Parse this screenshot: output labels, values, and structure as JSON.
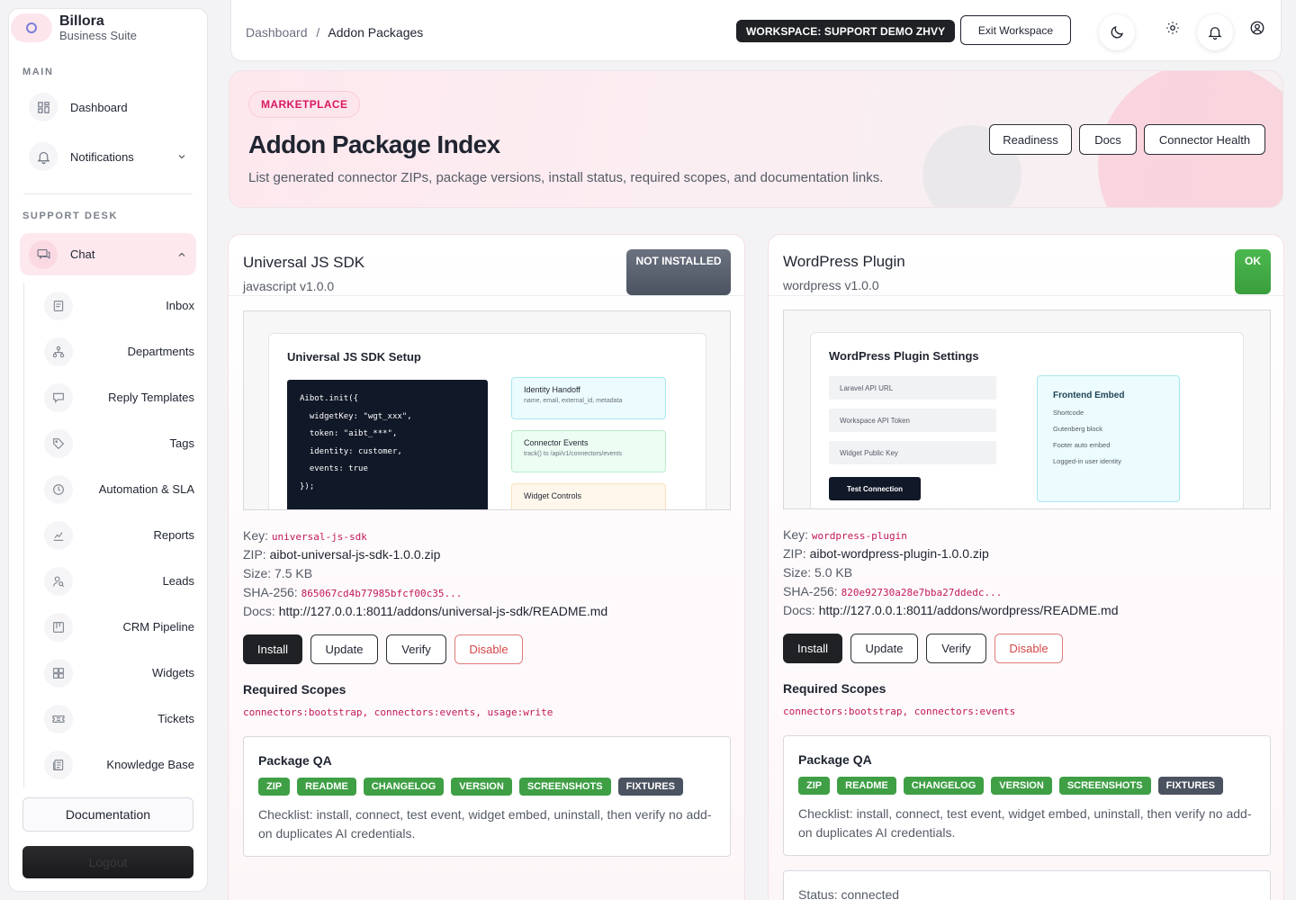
{
  "brand": {
    "name": "Billora",
    "subtitle": "Business Suite"
  },
  "sidebar": {
    "main_label": "MAIN",
    "support_label": "SUPPORT DESK",
    "main_items": [
      {
        "label": "Dashboard",
        "icon": "grid-icon"
      },
      {
        "label": "Notifications",
        "icon": "bell-icon"
      }
    ],
    "chat": {
      "label": "Chat",
      "icon": "chat-icon"
    },
    "chat_items": [
      {
        "label": "Inbox",
        "icon": "message-icon"
      },
      {
        "label": "Departments",
        "icon": "sitemap-icon"
      },
      {
        "label": "Reply Templates",
        "icon": "reply-icon"
      },
      {
        "label": "Tags",
        "icon": "tag-icon"
      },
      {
        "label": "Automation & SLA",
        "icon": "clock-icon"
      },
      {
        "label": "Reports",
        "icon": "chart-icon"
      },
      {
        "label": "Leads",
        "icon": "user-search-icon"
      },
      {
        "label": "CRM Pipeline",
        "icon": "kanban-icon"
      },
      {
        "label": "Widgets",
        "icon": "widgets-icon"
      },
      {
        "label": "Tickets",
        "icon": "ticket-icon"
      },
      {
        "label": "Knowledge Base",
        "icon": "book-icon"
      }
    ],
    "documentation": "Documentation",
    "logout": "Logout"
  },
  "topbar": {
    "crumb_root": "Dashboard",
    "crumb_sep": "/",
    "crumb_current": "Addon Packages",
    "workspace_badge": "WORKSPACE: SUPPORT DEMO ZHVY",
    "exit_label": "Exit Workspace",
    "icons": [
      "moon-icon",
      "gear-icon",
      "bell-icon",
      "user-circle-icon"
    ]
  },
  "hero": {
    "pill": "MARKETPLACE",
    "title": "Addon Package Index",
    "description": "List generated connector ZIPs, package versions, install status, required scopes, and documentation links.",
    "buttons": [
      "Readiness",
      "Docs",
      "Connector Health"
    ]
  },
  "cards": [
    {
      "title": "Universal JS SDK",
      "subtitle": "javascript v1.0.0",
      "status": "NOT INSTALLED",
      "status_color": "#5b6170",
      "preview": {
        "title": "Universal JS SDK Setup",
        "code": "Aibot.init({\n  widgetKey: \"wgt_xxx\",\n  token: \"aibt_***\",\n  identity: customer,\n  events: true\n});",
        "boxes": [
          {
            "title": "Identity Handoff",
            "sub": "name, email, external_id, metadata"
          },
          {
            "title": "Connector Events",
            "sub": "track() to /api/v1/connectors/events"
          },
          {
            "title": "Widget Controls",
            "sub": ""
          }
        ]
      },
      "key_label": "Key:",
      "key": "universal-js-sdk",
      "zip_label": "ZIP:",
      "zip": "aibot-universal-js-sdk-1.0.0.zip",
      "size_label": "Size:",
      "size": "7.5 KB",
      "sha_label": "SHA-256:",
      "sha": "865067cd4b77985bfcf00c35...",
      "docs_label": "Docs:",
      "docs": "http://127.0.0.1:8011/addons/universal-js-sdk/README.md",
      "actions": [
        "Install",
        "Update",
        "Verify",
        "Disable"
      ],
      "scopes_heading": "Required Scopes",
      "scopes": "connectors:bootstrap, connectors:events, usage:write",
      "qa_heading": "Package QA",
      "qa_tags": [
        "ZIP",
        "README",
        "CHANGELOG",
        "VERSION",
        "SCREENSHOTS",
        "FIXTURES"
      ],
      "qa_text": "Checklist: install, connect, test event, widget embed, uninstall, then verify no add-on duplicates AI credentials."
    },
    {
      "title": "WordPress Plugin",
      "subtitle": "wordpress v1.0.0",
      "status": "OK",
      "status_color": "#43ab46",
      "preview": {
        "title": "WordPress Plugin Settings",
        "fields": [
          "Laravel API URL",
          "Workspace API Token",
          "Widget Public Key"
        ],
        "button": "Test Connection",
        "embed_title": "Frontend Embed",
        "embed_items": [
          "Shortcode",
          "Gutenberg block",
          "Footer auto embed",
          "Logged-in user identity"
        ]
      },
      "key_label": "Key:",
      "key": "wordpress-plugin",
      "zip_label": "ZIP:",
      "zip": "aibot-wordpress-plugin-1.0.0.zip",
      "size_label": "Size:",
      "size": "5.0 KB",
      "sha_label": "SHA-256:",
      "sha": "820e92730a28e7bba27ddedc...",
      "docs_label": "Docs:",
      "docs": "http://127.0.0.1:8011/addons/wordpress/README.md",
      "actions": [
        "Install",
        "Update",
        "Verify",
        "Disable"
      ],
      "scopes_heading": "Required Scopes",
      "scopes": "connectors:bootstrap, connectors:events",
      "qa_heading": "Package QA",
      "qa_tags": [
        "ZIP",
        "README",
        "CHANGELOG",
        "VERSION",
        "SCREENSHOTS",
        "FIXTURES"
      ],
      "qa_text": "Checklist: install, connect, test event, widget embed, uninstall, then verify no add-on duplicates AI credentials.",
      "status_line": "Status: connected"
    }
  ]
}
